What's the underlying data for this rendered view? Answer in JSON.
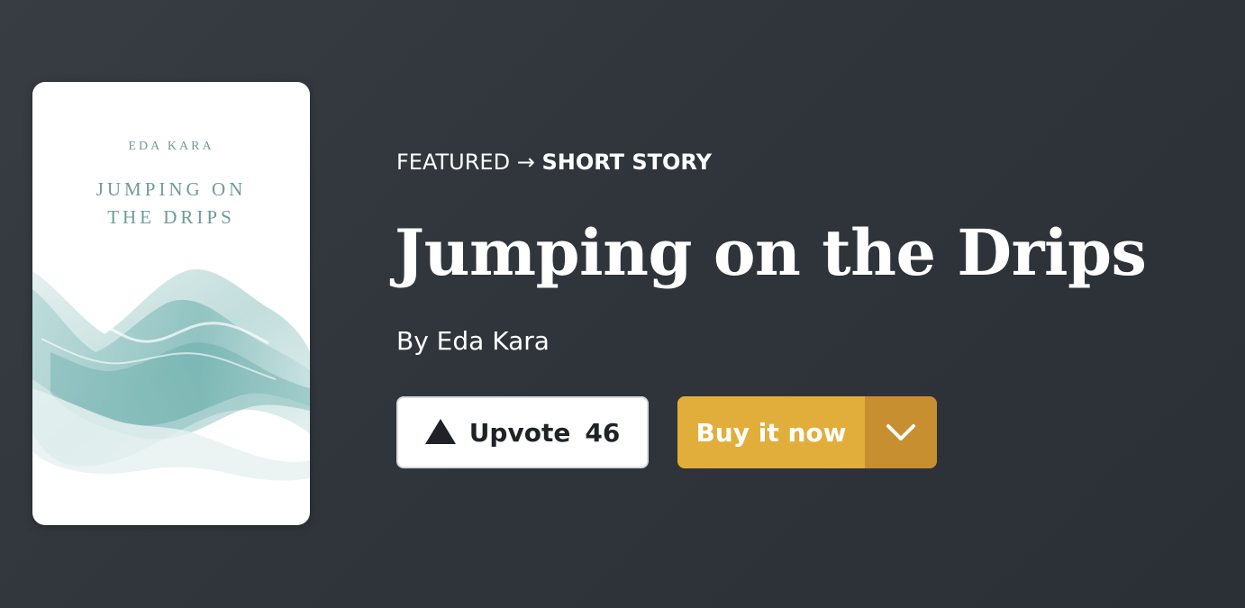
{
  "cover": {
    "author": "EDA KARA",
    "title": "JUMPING ON\nTHE DRIPS",
    "art_icon": "watercolor-wave-art",
    "accent_color": "#6e9c98"
  },
  "breadcrumb": {
    "parent": "FEATURED",
    "separator": "→",
    "current": "SHORT STORY"
  },
  "story": {
    "title": "Jumping on the Drips",
    "byline": "By Eda Kara"
  },
  "actions": {
    "upvote_label": "Upvote",
    "upvote_count": "46",
    "upvote_icon": "triangle-up-icon",
    "buy_label": "Buy it now",
    "buy_dropdown_icon": "chevron-down-icon",
    "buy_color": "#e2ae3b",
    "buy_dropdown_color": "#c88f31"
  },
  "colors": {
    "background": "#2f353b"
  }
}
